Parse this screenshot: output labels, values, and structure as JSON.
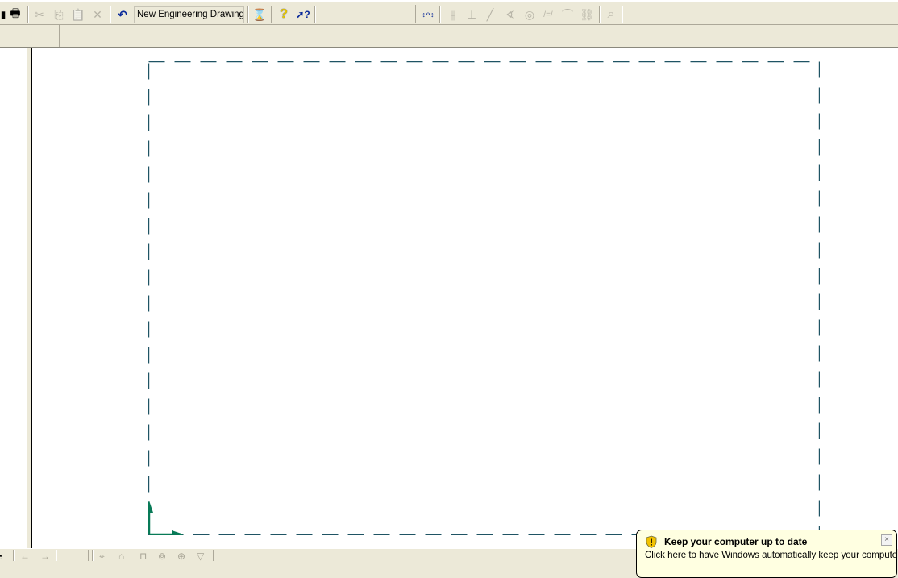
{
  "toolbar": {
    "drawing_name": "New Engineering Drawing",
    "icons": {
      "save": "save-icon",
      "print": "print-icon",
      "cut": "cut-icon",
      "copy": "copy-icon",
      "paste": "paste-icon",
      "delete": "delete-icon",
      "undo": "undo-icon",
      "hourglass": "hourglass-icon",
      "help": "help-icon",
      "whats_this": "whats-this-icon",
      "dimension": "dimension-icon",
      "parallel": "parallel-icon",
      "perpendicular": "perpendicular-icon",
      "line": "line-icon",
      "angle": "angle-icon",
      "concentric": "concentric-icon",
      "symmetric": "symmetric-icon",
      "tangent": "tangent-icon",
      "chain": "chain-icon",
      "zoom": "zoom-icon"
    },
    "glyphs": {
      "save": "▮",
      "print": "🖶",
      "cut": "✂",
      "copy": "⎘",
      "paste": "📋",
      "delete": "✕",
      "undo": "↶",
      "hourglass": "⌛",
      "help": "?",
      "whats_this": "➚?",
      "dimension": "↕ˣˣ↕",
      "parallel": "⫲",
      "perpendicular": "⊥",
      "line": "╱",
      "angle": "∢",
      "concentric": "◎",
      "symmetric": "/=/",
      "tangent": "⌒",
      "chain": "⛓",
      "zoom": "⌕"
    }
  },
  "statusbar": {
    "glyphs": [
      "◔",
      "←",
      "→",
      "⌖",
      "⌂",
      "⊓",
      "⊚",
      "⊕",
      "▽"
    ]
  },
  "sheet": {
    "border_color": "#1f5464",
    "axis_color": "#087a57"
  },
  "notification": {
    "title": "Keep your computer up to date",
    "body": "Click here to have Windows automatically keep your computer",
    "close_glyph": "×"
  }
}
